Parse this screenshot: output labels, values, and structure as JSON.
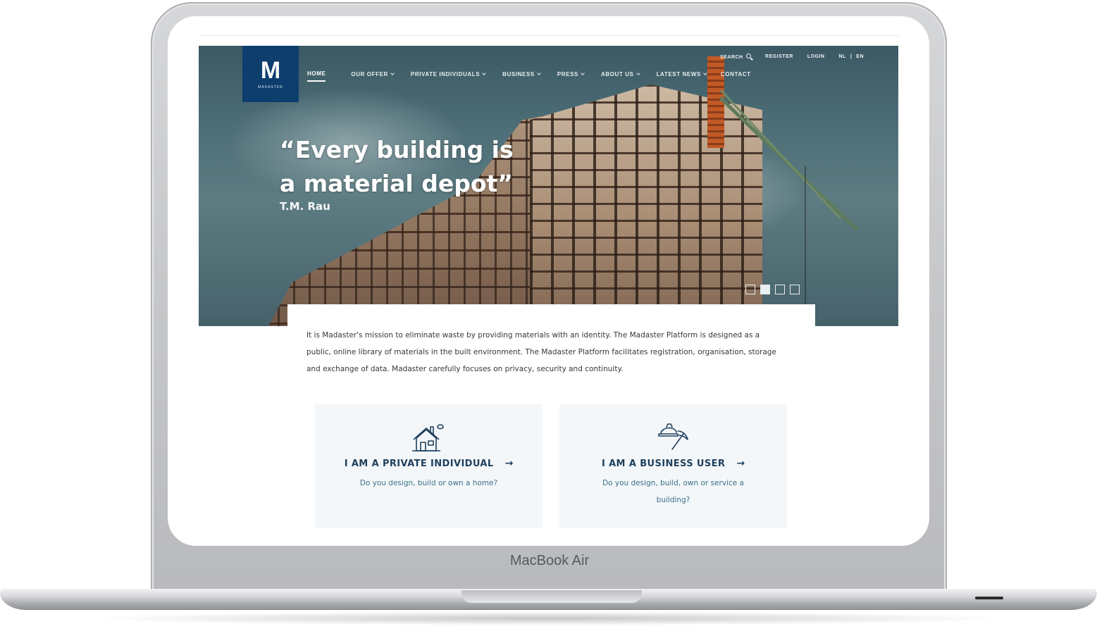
{
  "device": {
    "label": "MacBook Air"
  },
  "header": {
    "logo": {
      "mark": "M",
      "wordmark": "MADASTER"
    },
    "utility": [
      {
        "label": "SEARCH",
        "icon": "search-icon"
      },
      {
        "label": "REGISTER"
      },
      {
        "label": "LOGIN"
      },
      {
        "label": "NL"
      },
      {
        "label": "|"
      },
      {
        "label": "EN"
      }
    ],
    "nav": [
      {
        "label": "HOME",
        "active": true,
        "dropdown": false
      },
      {
        "label": "OUR OFFER",
        "dropdown": true
      },
      {
        "label": "PRIVATE INDIVIDUALS",
        "dropdown": true
      },
      {
        "label": "BUSINESS",
        "dropdown": true
      },
      {
        "label": "PRESS",
        "dropdown": true
      },
      {
        "label": "ABOUT US",
        "dropdown": true
      },
      {
        "label": "LATEST NEWS",
        "dropdown": true
      },
      {
        "label": "CONTACT",
        "dropdown": false
      }
    ]
  },
  "hero": {
    "quote_line1": "“Every building is",
    "quote_line2": "a material depot”",
    "author": "T.M. Rau",
    "slides_total": 4,
    "slide_active": 2
  },
  "main": {
    "mission": "It is Madaster's mission to eliminate waste by providing materials with an identity. The Madaster Platform is designed as a public, online library of materials in the built environment. The Madaster Platform facilitates registration, organisation, storage and exchange of data. Madaster carefully focuses on privacy, security and continuity.",
    "cta": [
      {
        "title": "I AM A PRIVATE INDIVIDUAL",
        "description": "Do you design, build or own a home?",
        "icon": "house-icon",
        "arrow": "→"
      },
      {
        "title": "I AM A BUSINESS USER",
        "description": "Do you design, build, own or service a building?",
        "icon": "hardhat-pickaxe-icon",
        "arrow": "→"
      }
    ]
  },
  "colors": {
    "brand": "#0d3e6e",
    "cta_title": "#1f3f5c",
    "cta_desc": "#3e6f86",
    "cta_bg": "#f3f7f9"
  }
}
